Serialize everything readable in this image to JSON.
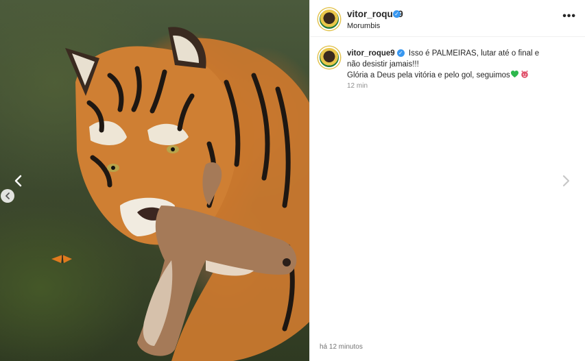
{
  "post": {
    "username": "vitor_roque9",
    "location": "Morumbis",
    "verified": true,
    "more_label": "•••"
  },
  "caption": {
    "username": "vitor_roque9",
    "text_line1": "Isso é PALMEIRAS, lutar até o final e não desistir jamais!!!",
    "text_line2": "Glória a Deus pela vitória e pelo gol, seguimos",
    "emojis": [
      "green-heart",
      "devil-face"
    ],
    "relative_time": "12 min"
  },
  "footer": {
    "posted_time": "há 12 minutos"
  },
  "carousel": {
    "prev_arrow": "‹",
    "next_arrow": "›"
  },
  "colors": {
    "verified_blue": "#3897f0",
    "heart_green": "#2db84d",
    "devil_purple": "#e0506a",
    "avatar_ring": "#e2c24b"
  },
  "media": {
    "description_icon": "tiger-image"
  }
}
